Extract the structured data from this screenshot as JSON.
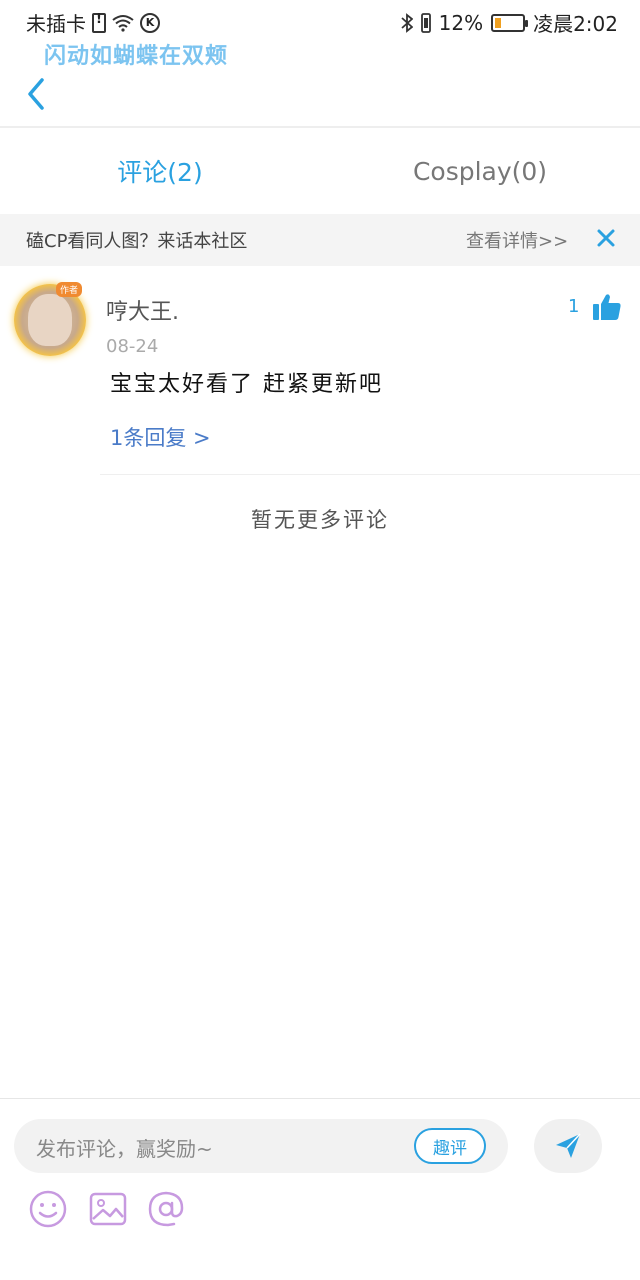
{
  "status_bar": {
    "carrier": "未插卡",
    "battery_percent": "12%",
    "battery_level": 0.12,
    "time": "凌晨2:02",
    "icons": [
      "sim-alert-icon",
      "wifi-icon",
      "k-icon",
      "bluetooth-icon",
      "vibrate-icon",
      "battery-icon"
    ]
  },
  "notification": {
    "text": "闪动如蝴蝶在双颊"
  },
  "tabs": [
    {
      "label": "评论(2)",
      "active": true
    },
    {
      "label": "Cosplay(0)",
      "active": false
    }
  ],
  "banner": {
    "text": "磕CP看同人图？来话本社区",
    "link": "查看详情>>"
  },
  "comment": {
    "avatar_badge": "作者",
    "author": "哼大王.",
    "date": "08-24",
    "content": "宝宝太好看了 赶紧更新吧",
    "replies": "1条回复 >",
    "likes": "1"
  },
  "footer_text": "暂无更多评论",
  "composer": {
    "placeholder": "发布评论，赢奖励~",
    "tag_label": "趣评",
    "tools": [
      "emoji-icon",
      "image-icon",
      "at-icon"
    ]
  },
  "colors": {
    "accent": "#2aa1e0",
    "link": "#4a7bc8",
    "tool_purple": "#c79ae0"
  }
}
